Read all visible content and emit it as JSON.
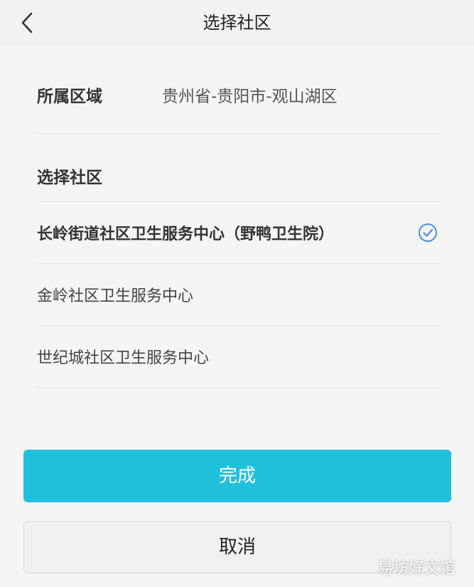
{
  "header": {
    "title": "选择社区",
    "back_icon": "chevron-left-icon"
  },
  "region": {
    "label": "所属区域",
    "value": "贵州省-贵阳市-观山湖区"
  },
  "community": {
    "section_title": "选择社区",
    "options": [
      {
        "label": "长岭街道社区卫生服务中心（野鸭卫生院）",
        "selected": true
      },
      {
        "label": "金岭社区卫生服务中心",
        "selected": false
      },
      {
        "label": "世纪城社区卫生服务中心",
        "selected": false
      }
    ],
    "check_icon": "check-circle-icon"
  },
  "actions": {
    "confirm_label": "完成",
    "cancel_label": "取消"
  },
  "watermark": "易坊好文馆",
  "colors": {
    "accent": "#21c1dd",
    "check": "#4a8fe0",
    "background": "#f5f5f5"
  }
}
